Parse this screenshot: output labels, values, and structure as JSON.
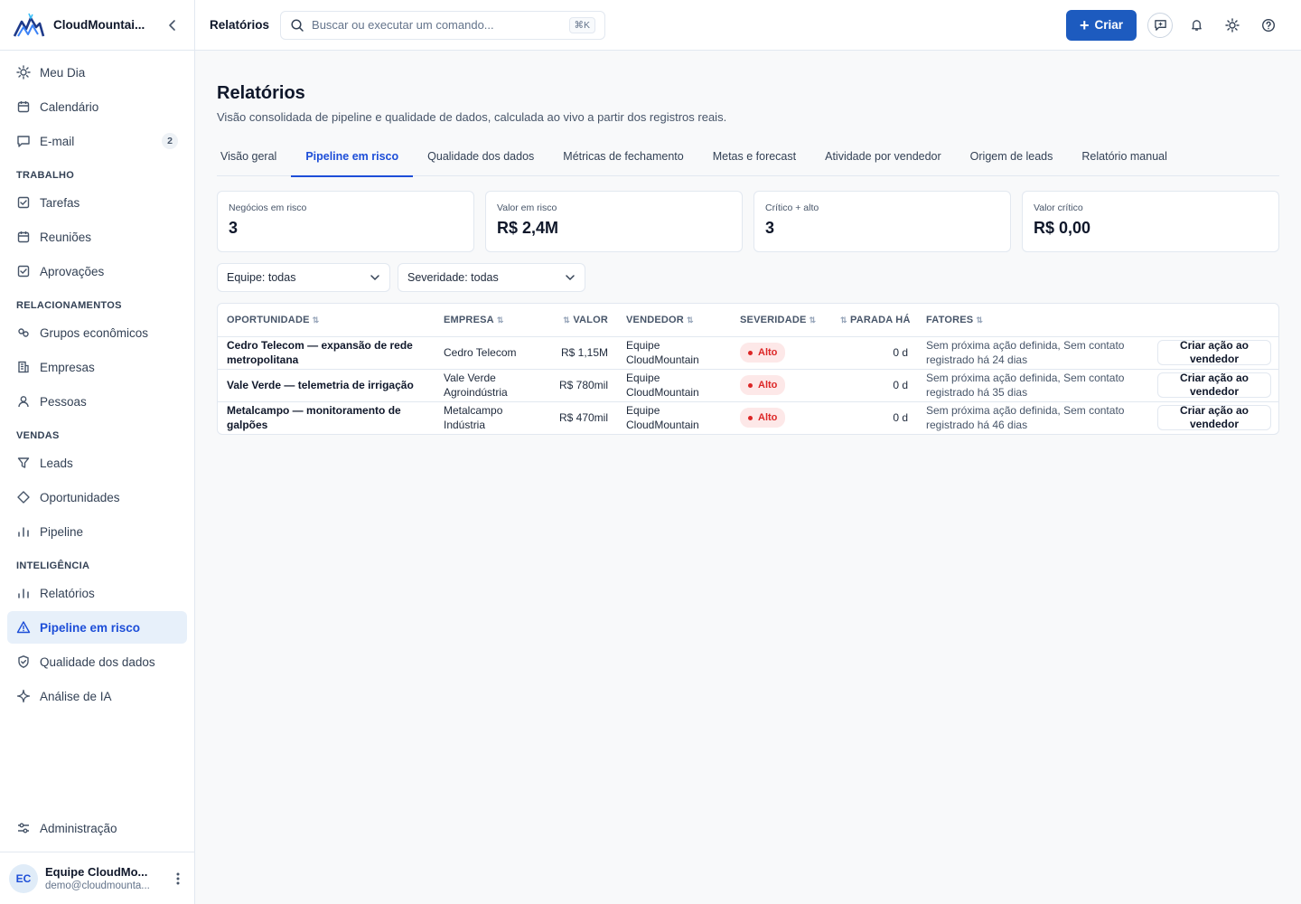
{
  "brand": {
    "name": "CloudMountai..."
  },
  "nav": {
    "top": [
      {
        "label": "Meu Dia",
        "icon": "sun-icon"
      },
      {
        "label": "Calendário",
        "icon": "calendar-icon"
      },
      {
        "label": "E-mail",
        "icon": "message-icon",
        "badge": "2"
      }
    ],
    "sections": [
      {
        "label": "TRABALHO",
        "items": [
          {
            "label": "Tarefas",
            "icon": "checkbox-icon"
          },
          {
            "label": "Reuniões",
            "icon": "calendar-icon"
          },
          {
            "label": "Aprovações",
            "icon": "checkbox-icon"
          }
        ]
      },
      {
        "label": "RELACIONAMENTOS",
        "items": [
          {
            "label": "Grupos econômicos",
            "icon": "link-icon"
          },
          {
            "label": "Empresas",
            "icon": "building-icon"
          },
          {
            "label": "Pessoas",
            "icon": "person-icon"
          }
        ]
      },
      {
        "label": "VENDAS",
        "items": [
          {
            "label": "Leads",
            "icon": "funnel-icon"
          },
          {
            "label": "Oportunidades",
            "icon": "diamond-icon"
          },
          {
            "label": "Pipeline",
            "icon": "bar-chart-icon"
          }
        ]
      },
      {
        "label": "INTELIGÊNCIA",
        "items": [
          {
            "label": "Relatórios",
            "icon": "bar-chart-icon"
          },
          {
            "label": "Pipeline em risco",
            "icon": "warning-icon",
            "active": true
          },
          {
            "label": "Qualidade dos dados",
            "icon": "shield-check-icon"
          },
          {
            "label": "Análise de IA",
            "icon": "sparkle-icon"
          }
        ]
      }
    ],
    "admin": {
      "label": "Administração",
      "icon": "sliders-icon"
    }
  },
  "user": {
    "initials": "EC",
    "name": "Equipe CloudMo...",
    "email": "demo@cloudmounta..."
  },
  "topbar": {
    "title": "Relatórios",
    "search_placeholder": "Buscar ou executar um comando...",
    "shortcut": "⌘K",
    "create_label": "Criar"
  },
  "page": {
    "title": "Relatórios",
    "subtitle": "Visão consolidada de pipeline e qualidade de dados, calculada ao vivo a partir dos registros reais."
  },
  "tabs": [
    {
      "label": "Visão geral"
    },
    {
      "label": "Pipeline em risco",
      "active": true
    },
    {
      "label": "Qualidade dos dados"
    },
    {
      "label": "Métricas de fechamento"
    },
    {
      "label": "Metas e forecast"
    },
    {
      "label": "Atividade por vendedor"
    },
    {
      "label": "Origem de leads"
    },
    {
      "label": "Relatório manual"
    }
  ],
  "kpis": [
    {
      "label": "Negócios em risco",
      "value": "3"
    },
    {
      "label": "Valor em risco",
      "value": "R$ 2,4M"
    },
    {
      "label": "Crítico + alto",
      "value": "3"
    },
    {
      "label": "Valor crítico",
      "value": "R$ 0,00"
    }
  ],
  "filters": {
    "team": "Equipe: todas",
    "severity": "Severidade: todas"
  },
  "table": {
    "columns": {
      "opportunity": "OPORTUNIDADE",
      "company": "EMPRESA",
      "value": "VALOR",
      "seller": "VENDEDOR",
      "severity": "SEVERIDADE",
      "stalled": "PARADA HÁ",
      "factors": "FATORES"
    },
    "rows": [
      {
        "opportunity": "Cedro Telecom — expansão de rede metropolitana",
        "company": "Cedro Telecom",
        "value": "R$ 1,15M",
        "seller": "Equipe CloudMountain",
        "severity": "Alto",
        "stalled": "0 d",
        "factors": "Sem próxima ação definida, Sem contato registrado há 24 dias",
        "action": "Criar ação ao vendedor"
      },
      {
        "opportunity": "Vale Verde — telemetria de irrigação",
        "company": "Vale Verde Agroindústria",
        "value": "R$ 780mil",
        "seller": "Equipe CloudMountain",
        "severity": "Alto",
        "stalled": "0 d",
        "factors": "Sem próxima ação definida, Sem contato registrado há 35 dias",
        "action": "Criar ação ao vendedor"
      },
      {
        "opportunity": "Metalcampo — monitoramento de galpões",
        "company": "Metalcampo Indústria",
        "value": "R$ 470mil",
        "seller": "Equipe CloudMountain",
        "severity": "Alto",
        "stalled": "0 d",
        "factors": "Sem próxima ação definida, Sem contato registrado há 46 dias",
        "action": "Criar ação ao vendedor"
      }
    ]
  },
  "colors": {
    "accent": "#1d5bbf",
    "active_bg": "#e7f0fa",
    "severity_high": "#dc2626"
  }
}
